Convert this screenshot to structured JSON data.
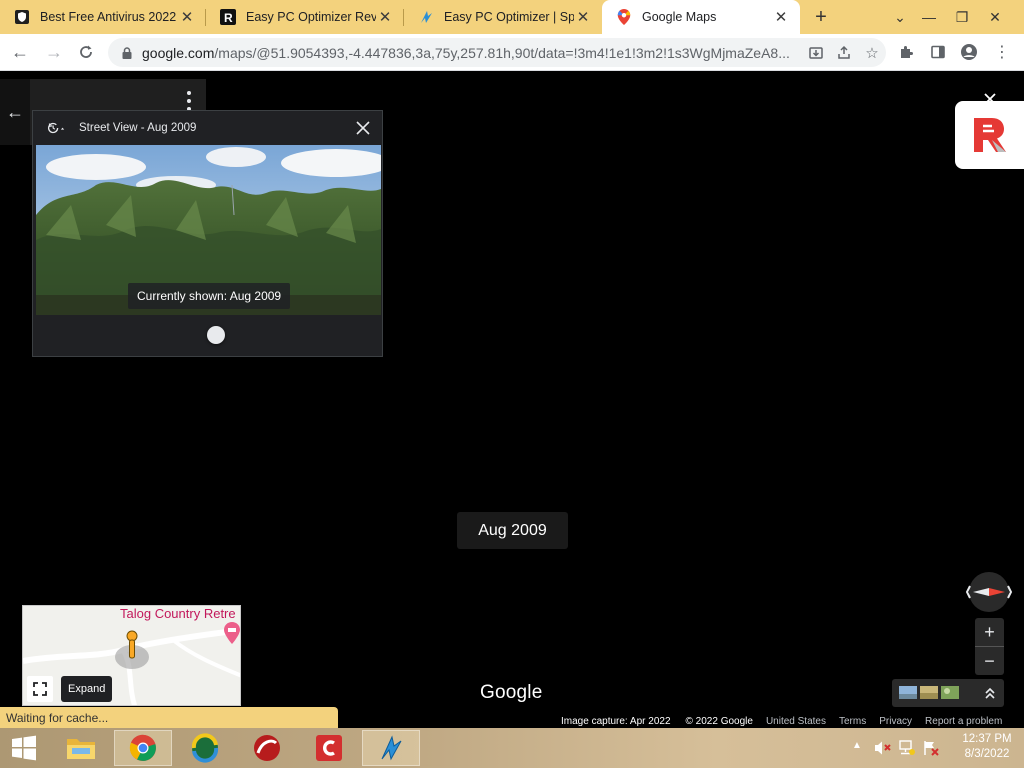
{
  "browser": {
    "tabs": [
      {
        "title": "Best Free Antivirus 2022",
        "favicon": "shield-icon",
        "active": false
      },
      {
        "title": "Easy PC Optimizer Review",
        "favicon": "r-logo-icon",
        "active": false
      },
      {
        "title": "Easy PC Optimizer | Spee",
        "favicon": "optimizer-bolt-icon",
        "active": false
      },
      {
        "title": "Google Maps",
        "favicon": "maps-pin-icon",
        "active": true
      }
    ],
    "url_host": "google.com",
    "url_path": "/maps/@51.9054393,-4.447836,3a,75y,257.81h,90t/data=!3m4!1e1!3m2!1s3WgMjmaZeA8..."
  },
  "street_view_card": {
    "header": "Street View - Aug 2009",
    "caption": "Currently shown: Aug 2009"
  },
  "date_label": "Aug 2009",
  "minimap": {
    "place_name": "Talog Country Retre",
    "expand_tooltip": "Expand"
  },
  "google_logo": "Google",
  "attribution": {
    "capture": "Image capture: Apr 2022",
    "copyright": "© 2022 Google",
    "links": [
      "United States",
      "Terms",
      "Privacy",
      "Report a problem"
    ]
  },
  "status_text": "Waiting for cache...",
  "zoom": {
    "in": "+",
    "out": "−"
  },
  "taskbar": {
    "time": "12:37 PM",
    "date": "8/3/2022"
  },
  "colors": {
    "tabstrip": "#f3d27d",
    "accent_red": "#ea4335",
    "place_pink": "#c2185b"
  }
}
